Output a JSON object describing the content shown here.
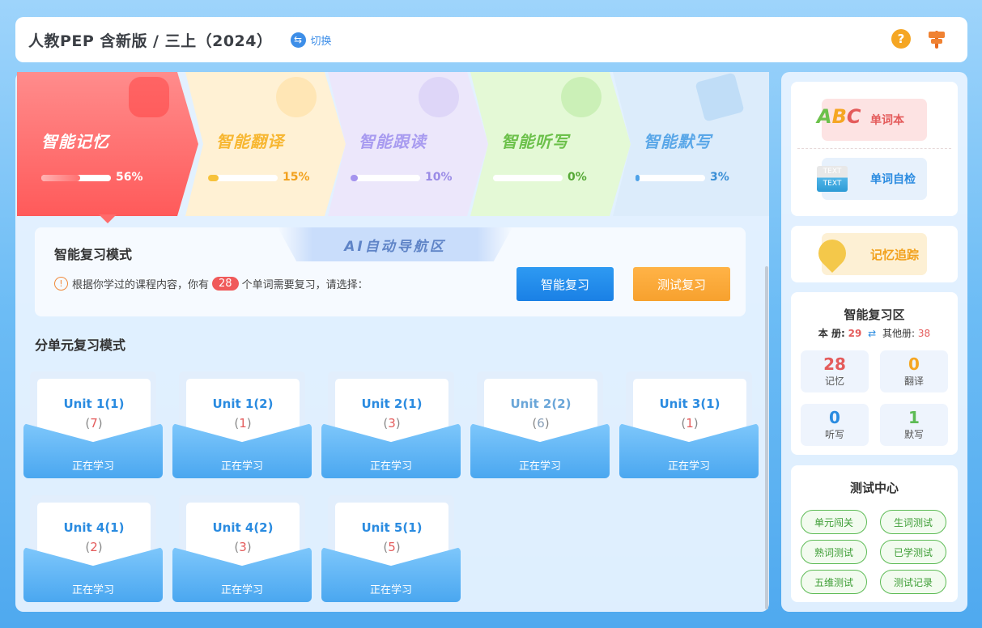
{
  "header": {
    "title": "人教PEP 含新版 / 三上（2024）",
    "switch_label": "切换"
  },
  "steps": [
    {
      "label": "智能记忆",
      "progress_pct": "56%",
      "progress": 0.56
    },
    {
      "label": "智能翻译",
      "progress_pct": "15%",
      "progress": 0.15
    },
    {
      "label": "智能跟读",
      "progress_pct": "10%",
      "progress": 0.1
    },
    {
      "label": "智能听写",
      "progress_pct": "0%",
      "progress": 0
    },
    {
      "label": "智能默写",
      "progress_pct": "3%",
      "progress": 0.03
    }
  ],
  "review": {
    "title": "智能复习模式",
    "banner": "AI自动导航区",
    "tip_prefix": "根据你学过的课程内容，你有",
    "count": "28",
    "tip_suffix": "个单词需要复习，请选择：",
    "btn_smart": "智能复习",
    "btn_test": "测试复习"
  },
  "units_title": "分单元复习模式",
  "units": [
    {
      "name": "Unit 1(1)",
      "count": "7",
      "status": "正在学习"
    },
    {
      "name": "Unit 1(2)",
      "count": "1",
      "status": "正在学习"
    },
    {
      "name": "Unit 2(1)",
      "count": "3",
      "status": "正在学习"
    },
    {
      "name": "Unit 2(2)",
      "count": "6",
      "status": "正在学习"
    },
    {
      "name": "Unit 3(1)",
      "count": "1",
      "status": "正在学习"
    },
    {
      "name": "Unit 4(1)",
      "count": "2",
      "status": "正在学习"
    },
    {
      "name": "Unit 4(2)",
      "count": "3",
      "status": "正在学习"
    },
    {
      "name": "Unit 5(1)",
      "count": "5",
      "status": "正在学习"
    }
  ],
  "sidebar": {
    "word_book": "单词本",
    "word_check": "单词自检",
    "memory_track": "记忆追踪",
    "review_area": {
      "title": "智能复习区",
      "this_book_label": "本 册:",
      "this_book": "29",
      "other_label": "其他册:",
      "other": "38",
      "stats": [
        {
          "value": "28",
          "label": "记忆",
          "color": "#e45b5b"
        },
        {
          "value": "0",
          "label": "翻译",
          "color": "#f5a623"
        },
        {
          "value": "0",
          "label": "听写",
          "color": "#2a8be0"
        },
        {
          "value": "1",
          "label": "默写",
          "color": "#5dbb55"
        }
      ]
    },
    "test_center": {
      "title": "测试中心",
      "items": [
        "单元闯关",
        "生词测试",
        "熟词测试",
        "已学测试",
        "五维测试",
        "测试记录"
      ]
    }
  },
  "icons": {
    "help": "question-icon",
    "guide": "signpost-icon",
    "switch": "swap-icon",
    "arrows": "exchange-icon"
  },
  "colors": {
    "accent": "#1a80e5",
    "orange": "#f7a12e",
    "red": "#f05a5a",
    "green": "#5dbb55"
  }
}
